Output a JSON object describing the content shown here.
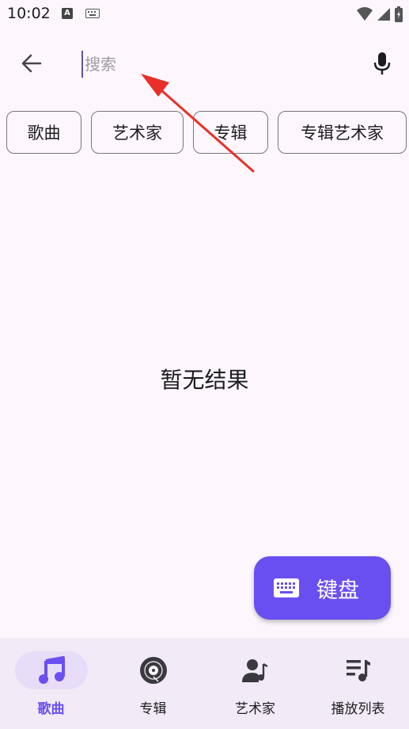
{
  "status_bar": {
    "time": "10:02",
    "notif_letter": "A"
  },
  "search": {
    "placeholder": "搜索",
    "value": ""
  },
  "chips": [
    {
      "label": "歌曲"
    },
    {
      "label": "艺术家"
    },
    {
      "label": "专辑"
    },
    {
      "label": "专辑艺术家"
    }
  ],
  "empty_state": {
    "text": "暂无结果"
  },
  "fab": {
    "label": "键盘"
  },
  "bottom_nav": {
    "items": [
      {
        "label": "歌曲",
        "active": true
      },
      {
        "label": "专辑",
        "active": false
      },
      {
        "label": "艺术家",
        "active": false
      },
      {
        "label": "播放列表",
        "active": false
      }
    ]
  },
  "colors": {
    "accent": "#6a4ff0",
    "background": "#fdf7fd",
    "nav_background": "#f2ebf7",
    "annotation_arrow": "#e8302a"
  }
}
